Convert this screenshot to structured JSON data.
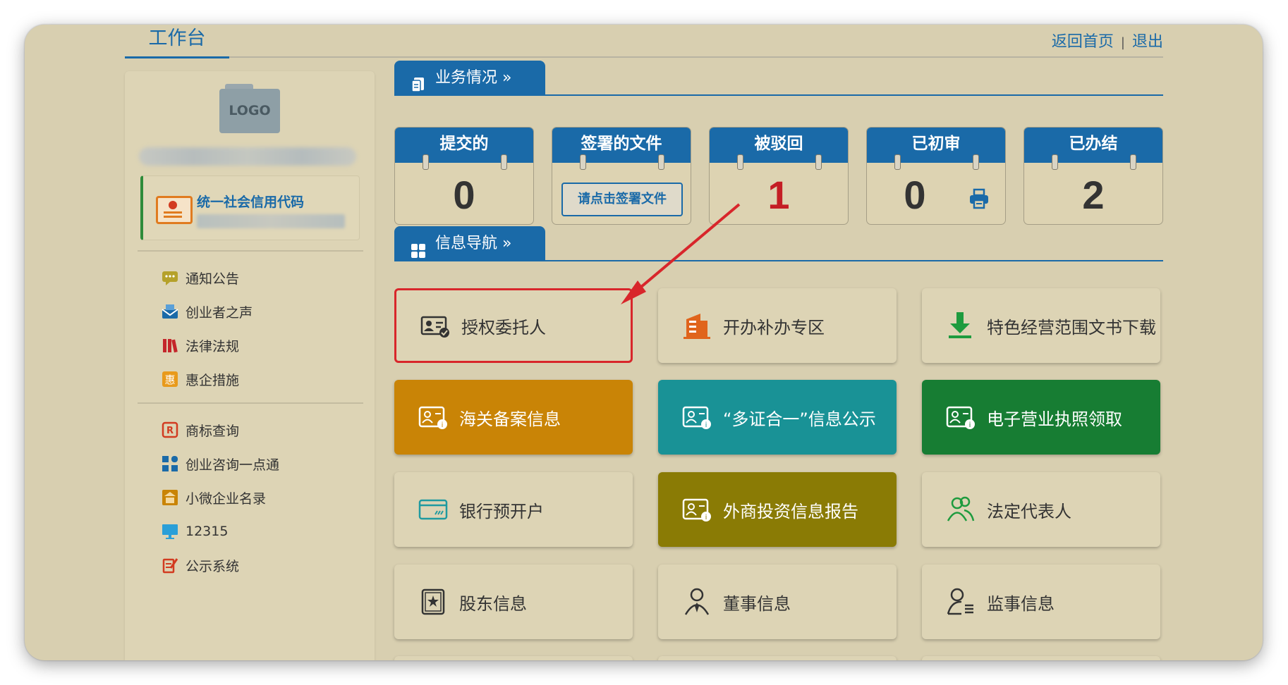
{
  "header": {
    "title": "工作台",
    "home_link": "返回首页",
    "separator": "|",
    "logout_link": "退出"
  },
  "sidebar": {
    "logo_text": "LOGO",
    "credit_label": "统一社会信用代码",
    "menu_group1": [
      {
        "label": "通知公告",
        "icon": "notice-icon"
      },
      {
        "label": "创业者之声",
        "icon": "mail-icon"
      },
      {
        "label": "法律法规",
        "icon": "books-icon"
      },
      {
        "label": "惠企措施",
        "icon": "benefit-icon"
      }
    ],
    "menu_group2": [
      {
        "label": "商标查询",
        "icon": "trademark-icon"
      },
      {
        "label": "创业咨询一点通",
        "icon": "grid-icon"
      },
      {
        "label": "小微企业名录",
        "icon": "enterprise-icon"
      },
      {
        "label": "12315",
        "icon": "monitor-icon"
      },
      {
        "label": "公示系统",
        "icon": "publish-icon"
      }
    ]
  },
  "business": {
    "section_title": "业务情况 »",
    "stats": [
      {
        "label": "提交的",
        "value": "0"
      },
      {
        "label": "签署的文件",
        "button": "请点击签署文件"
      },
      {
        "label": "被驳回",
        "value": "1"
      },
      {
        "label": "已初审",
        "value": "0"
      },
      {
        "label": "已办结",
        "value": "2"
      }
    ]
  },
  "nav": {
    "section_title": "信息导航 »",
    "cards": [
      {
        "label": "授权委托人",
        "icon": "id-card-icon"
      },
      {
        "label": "开办补办专区",
        "icon": "building-icon"
      },
      {
        "label": "特色经营范围文书下载",
        "icon": "download-icon"
      },
      {
        "label": "海关备案信息",
        "icon": "profile-info-icon"
      },
      {
        "label": "“多证合一”信息公示",
        "icon": "profile-info-icon"
      },
      {
        "label": "电子营业执照领取",
        "icon": "profile-info-icon"
      },
      {
        "label": "银行预开户",
        "icon": "bank-card-icon"
      },
      {
        "label": "外商投资信息报告",
        "icon": "profile-info-icon"
      },
      {
        "label": "法定代表人",
        "icon": "people-icon"
      },
      {
        "label": "股东信息",
        "icon": "certificate-icon"
      },
      {
        "label": "董事信息",
        "icon": "person-icon"
      },
      {
        "label": "监事信息",
        "icon": "supervisor-icon"
      }
    ]
  },
  "colors": {
    "primary": "#1a6aa8",
    "background": "#d8cfb0",
    "highlight": "#d8262b",
    "rejected": "#c41e25",
    "orange": "#c98406",
    "teal": "#199296",
    "green": "#177d33",
    "olive": "#8a7b05"
  }
}
